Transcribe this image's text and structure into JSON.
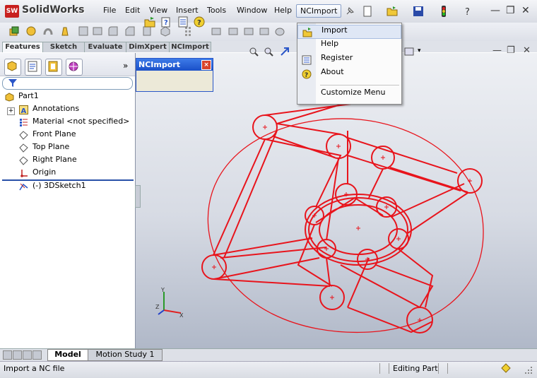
{
  "app": {
    "logo_mark": "SW",
    "logo_name": "SolidWorks"
  },
  "menu": {
    "items": [
      "File",
      "Edit",
      "View",
      "Insert",
      "Tools",
      "Window",
      "Help"
    ],
    "ncimport": "NCImport"
  },
  "feature_tabs": [
    "Features",
    "Sketch",
    "Evaluate",
    "DimXpert",
    "NCImport"
  ],
  "panel": {
    "more": "»",
    "tree": [
      {
        "label": "Part1",
        "icon": "part-icon"
      },
      {
        "label": "Annotations",
        "icon": "annotations-icon"
      },
      {
        "label": "Material <not specified>",
        "icon": "material-icon"
      },
      {
        "label": "Front Plane",
        "icon": "plane-icon"
      },
      {
        "label": "Top Plane",
        "icon": "plane-icon"
      },
      {
        "label": "Right Plane",
        "icon": "plane-icon"
      },
      {
        "label": "Origin",
        "icon": "origin-icon"
      },
      {
        "label": "(-) 3DSketch1",
        "icon": "sketch-icon"
      }
    ]
  },
  "ncimport_window": {
    "title": "NCImport",
    "close": "×"
  },
  "dropdown": {
    "items": [
      "Import",
      "Help",
      "Register",
      "About"
    ],
    "customize": "Customize Menu"
  },
  "bottom_tabs": [
    "Model",
    "Motion Study 1"
  ],
  "status": {
    "message": "Import a NC file",
    "mode": "Editing Part"
  },
  "colors": {
    "sketch": "#e8141c",
    "accent": "#2a56c8"
  }
}
